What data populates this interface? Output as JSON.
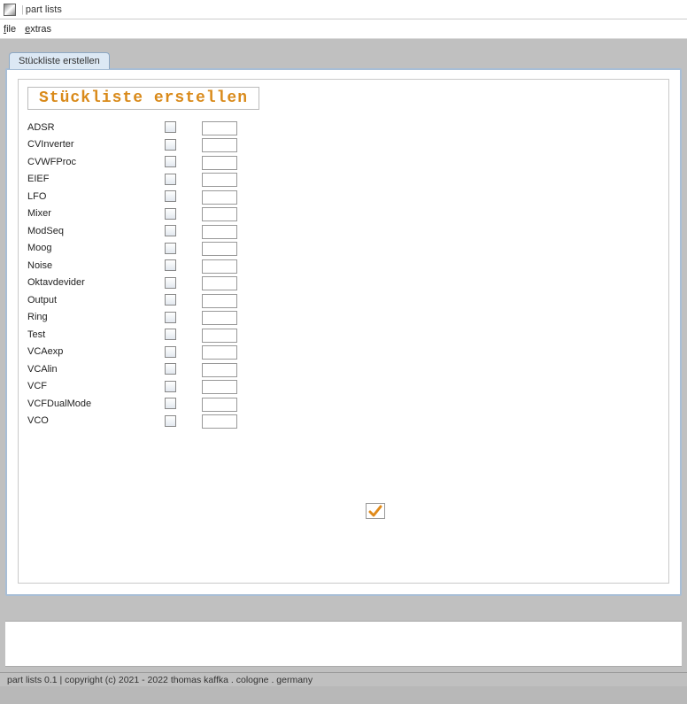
{
  "window": {
    "title": "part lists"
  },
  "menu": {
    "file": "file",
    "extras": "extras"
  },
  "tab": {
    "label": "Stückliste erstellen"
  },
  "heading": "Stückliste erstellen",
  "items": [
    {
      "name": "ADSR"
    },
    {
      "name": "CVInverter"
    },
    {
      "name": "CVWFProc"
    },
    {
      "name": "EIEF"
    },
    {
      "name": "LFO"
    },
    {
      "name": "Mixer"
    },
    {
      "name": "ModSeq"
    },
    {
      "name": "Moog"
    },
    {
      "name": "Noise"
    },
    {
      "name": "Oktavdevider"
    },
    {
      "name": "Output"
    },
    {
      "name": "Ring"
    },
    {
      "name": "Test"
    },
    {
      "name": "VCAexp"
    },
    {
      "name": "VCAlin"
    },
    {
      "name": "VCF"
    },
    {
      "name": "VCFDualMode"
    },
    {
      "name": "VCO"
    }
  ],
  "status": "part lists 0.1 | copyright (c) 2021 - 2022 thomas kaffka . cologne . germany"
}
